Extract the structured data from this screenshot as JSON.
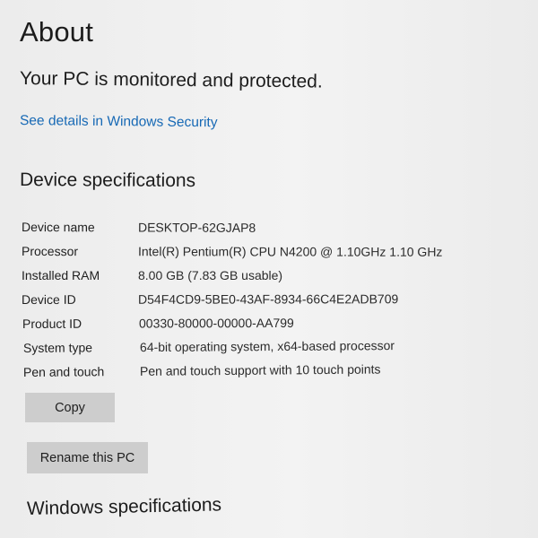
{
  "page": {
    "title": "About",
    "status_text": "Your PC is monitored and protected.",
    "security_link": "See details in Windows Security"
  },
  "device_specifications": {
    "heading": "Device specifications",
    "rows": [
      {
        "label": "Device name",
        "value": "DESKTOP-62GJAP8"
      },
      {
        "label": "Processor",
        "value": "Intel(R) Pentium(R) CPU N4200 @ 1.10GHz   1.10 GHz"
      },
      {
        "label": "Installed RAM",
        "value": "8.00 GB (7.83 GB usable)"
      },
      {
        "label": "Device ID",
        "value": "D54F4CD9-5BE0-43AF-8934-66C4E2ADB709"
      },
      {
        "label": "Product ID",
        "value": "00330-80000-00000-AA799"
      },
      {
        "label": "System type",
        "value": "64-bit operating system, x64-based processor"
      },
      {
        "label": "Pen and touch",
        "value": "Pen and touch support with 10 touch points"
      }
    ],
    "copy_button": "Copy",
    "rename_button": "Rename this PC"
  },
  "windows_specifications": {
    "heading": "Windows specifications"
  }
}
